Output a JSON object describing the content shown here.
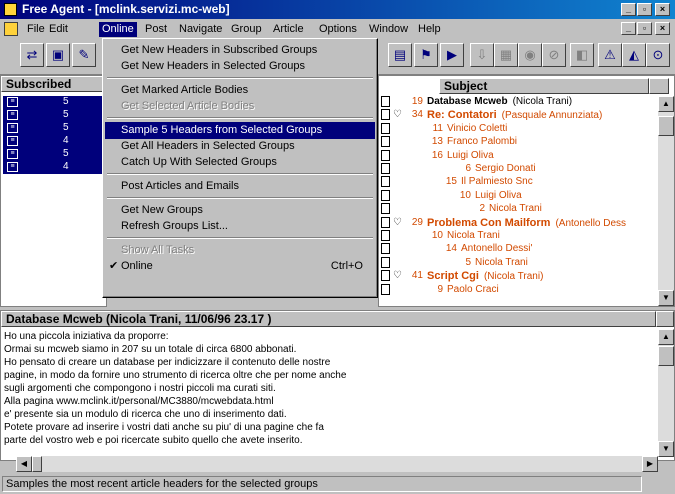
{
  "window": {
    "title": "Free Agent - [mclink.servizi.mc-web]"
  },
  "menubar": [
    "File",
    "Edit",
    "Online",
    "Post",
    "Navigate",
    "Group",
    "Article",
    "Options",
    "Window",
    "Help"
  ],
  "toolbar_icons": [
    "connect-icon",
    "group-icon",
    "article-icon",
    "flag-icon",
    "delete-icon",
    "keep-icon",
    "mark-icon",
    "disk-icon",
    "no-icon",
    "pin-icon",
    "tree-icon",
    "link-icon"
  ],
  "groups": {
    "header": "Subscribed",
    "rows": [
      {
        "count": "5"
      },
      {
        "count": "5"
      },
      {
        "count": "5"
      },
      {
        "count": "4"
      },
      {
        "count": "5"
      },
      {
        "count": "4"
      }
    ]
  },
  "online_menu": [
    {
      "label": "Get New Headers in Subscribed Groups"
    },
    {
      "label": "Get New Headers in Selected Groups"
    },
    {
      "sep": true
    },
    {
      "label": "Get Marked Article Bodies"
    },
    {
      "label": "Get Selected Article Bodies",
      "disabled": true
    },
    {
      "sep": true
    },
    {
      "label": "Sample 5 Headers from Selected Groups",
      "highlight": true
    },
    {
      "label": "Get All Headers in Selected Groups"
    },
    {
      "label": "Catch Up With Selected Groups"
    },
    {
      "sep": true
    },
    {
      "label": "Post Articles and Emails"
    },
    {
      "sep": true
    },
    {
      "label": "Get New Groups"
    },
    {
      "label": "Refresh Groups List..."
    },
    {
      "sep": true
    },
    {
      "label": "Show All Tasks",
      "disabled": true
    },
    {
      "label": "Online",
      "shortcut": "Ctrl+O",
      "checked": true
    }
  ],
  "articles": {
    "header": "Subject",
    "rows": [
      {
        "count": "19",
        "subject": "Database Mcweb",
        "author": "(Nicola Trani)",
        "indent": 0,
        "type": "selected"
      },
      {
        "count": "34",
        "subject": "Re: Contatori",
        "author": "(Pasquale Annunziata)",
        "indent": 0,
        "type": "thread"
      },
      {
        "count": "11",
        "subject": "Vinicio Coletti",
        "indent": 1
      },
      {
        "count": "13",
        "subject": "Franco Palombi",
        "indent": 1
      },
      {
        "count": "16",
        "subject": "Luigi Oliva",
        "indent": 1
      },
      {
        "count": "6",
        "subject": "Sergio Donati",
        "indent": 3
      },
      {
        "count": "15",
        "subject": "Il Palmiesto Snc",
        "indent": 2
      },
      {
        "count": "10",
        "subject": "Luigi Oliva",
        "indent": 3
      },
      {
        "count": "2",
        "subject": "Nicola Trani",
        "indent": 4
      },
      {
        "count": "29",
        "subject": "Problema Con Mailform",
        "author": "(Antonello Dess",
        "indent": 0,
        "type": "thread"
      },
      {
        "count": "10",
        "subject": "Nicola Trani",
        "indent": 1
      },
      {
        "count": "14",
        "subject": "Antonello Dessi'",
        "indent": 2
      },
      {
        "count": "5",
        "subject": "Nicola Trani",
        "indent": 3
      },
      {
        "count": "41",
        "subject": "Script Cgi",
        "author": "(Nicola Trani)",
        "indent": 0,
        "type": "thread"
      },
      {
        "count": "9",
        "subject": "Paolo Craci",
        "indent": 1
      }
    ]
  },
  "message": {
    "header": "Database Mcweb (Nicola Trani, 11/06/96 23.17 )",
    "lines": [
      "Ho una piccola iniziativa da proporre:",
      "Ormai su mcweb siamo in 207 su un totale di circa 6800 abbonati.",
      "Ho pensato di creare un database per indicizzare il contenuto delle nostre",
      "pagine, in modo da fornire uno strumento di ricerca oltre che per nome anche",
      "sugli argomenti che compongono i nostri piccoli ma curati siti.",
      "Alla pagina www.mclink.it/personal/MC3880/mcwebdata.html",
      "e' presente sia un modulo di ricerca che uno di inserimento dati.",
      "Potete provare ad inserire i vostri dati anche su piu' di una pagine che fa",
      "parte del vostro web e poi ricercate subito quello che avete inserito."
    ]
  },
  "status": {
    "text": "Samples the most recent article headers for the selected groups"
  }
}
